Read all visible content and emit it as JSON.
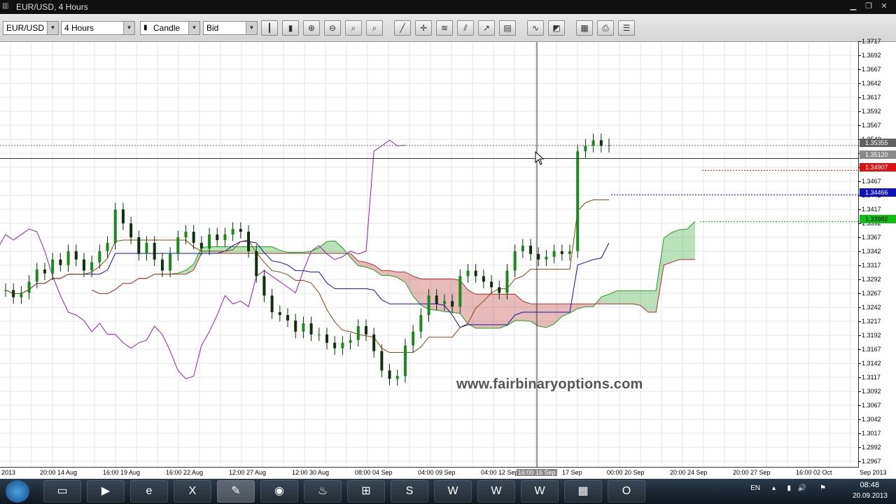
{
  "window": {
    "title": "EUR/USD, 4 Hours"
  },
  "toolbar": {
    "symbol": "EUR/USD",
    "period": "4 Hours",
    "chart_type": "Candle",
    "price_type": "Bid"
  },
  "price_axis": {
    "ticks": [
      "1.3717",
      "1.3692",
      "1.3667",
      "1.3642",
      "1.3617",
      "1.3592",
      "1.3567",
      "1.3542",
      "1.3517",
      "1.3492",
      "1.3467",
      "1.3442",
      "1.3417",
      "1.3392",
      "1.3367",
      "1.3342",
      "1.3317",
      "1.3292",
      "1.3267",
      "1.3242",
      "1.3217",
      "1.3192",
      "1.3167",
      "1.3142",
      "1.3117",
      "1.3092",
      "1.3067",
      "1.3042",
      "1.3017",
      "1.2992",
      "1.2967"
    ],
    "labels": {
      "current_gray": "1.35355",
      "current_gray2": "1.35120",
      "red_line": "1.34907",
      "blue_line": "1.34466",
      "green_line": "1.33982"
    },
    "colors": {
      "red": "#e01010",
      "blue": "#1010c0",
      "green": "#10c010",
      "gray": "#606060"
    }
  },
  "time_axis": {
    "ticks": [
      "2013",
      "20:00 14 Aug",
      "16:00 19 Aug",
      "16:00 22 Aug",
      "12:00 27 Aug",
      "12:00 30 Aug",
      "08:00 04 Sep",
      "04:00 09 Sep",
      "04:00 12 Sep",
      "16:00 16 Sep",
      "17 Sep",
      "00:00 20 Sep",
      "20:00 24 Sep",
      "20:00 27 Sep",
      "16:00 02 Oct",
      "Sep 2013"
    ]
  },
  "watermark": "www.fairbinaryoptions.com",
  "taskbar": {
    "apps": [
      "folder",
      "media",
      "ie",
      "excel",
      "paint",
      "chrome",
      "app",
      "network",
      "skype",
      "word",
      "word",
      "word",
      "archive",
      "opera"
    ],
    "lang": "EN",
    "time": "08:48",
    "date": "20.09.2013"
  },
  "chart_data": {
    "type": "candlestick",
    "title": "EUR/USD, 4 Hours",
    "xlabel": "",
    "ylabel": "",
    "ylim": [
      1.2955,
      1.3722
    ],
    "grid": true,
    "indicator": "Ichimoku Kinko Hyo",
    "close_series": [
      1.3275,
      1.3262,
      1.327,
      1.329,
      1.3312,
      1.3305,
      1.333,
      1.332,
      1.3345,
      1.333,
      1.331,
      1.3325,
      1.3345,
      1.336,
      1.342,
      1.3395,
      1.337,
      1.334,
      1.336,
      1.333,
      1.331,
      1.334,
      1.337,
      1.338,
      1.336,
      1.335,
      1.3375,
      1.3365,
      1.3375,
      1.3385,
      1.338,
      1.3345,
      1.33,
      1.3265,
      1.3235,
      1.323,
      1.322,
      1.32,
      1.3215,
      1.3195,
      1.3195,
      1.318,
      1.317,
      1.318,
      1.3185,
      1.321,
      1.3195,
      1.3165,
      1.313,
      1.3115,
      1.312,
      1.3175,
      1.32,
      1.323,
      1.3265,
      1.325,
      1.3255,
      1.3245,
      1.33,
      1.331,
      1.33,
      1.329,
      1.328,
      1.327,
      1.331,
      1.3345,
      1.3355,
      1.334,
      1.333,
      1.3335,
      1.3345,
      1.334,
      1.3345,
      1.3525,
      1.3535,
      1.3545,
      1.3535,
      1.3536
    ]
  }
}
